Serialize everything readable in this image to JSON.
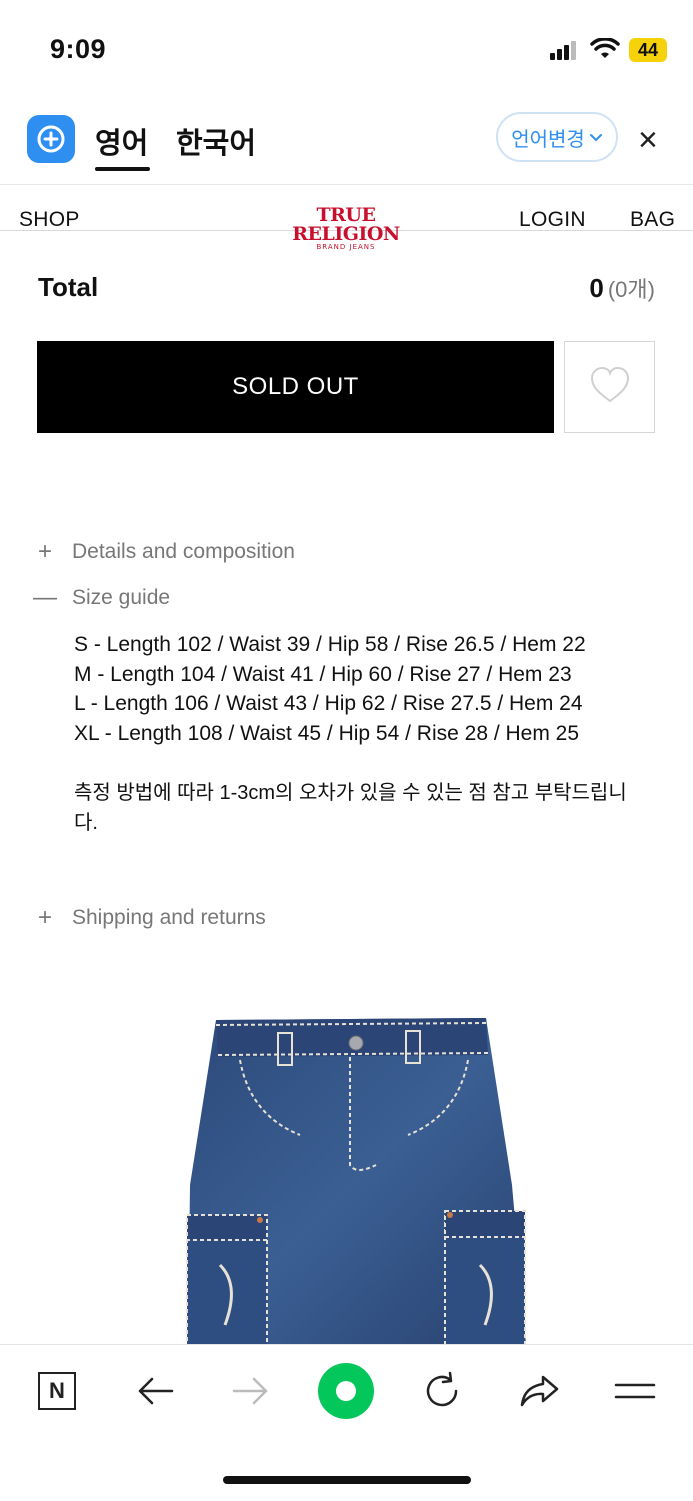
{
  "status_bar": {
    "time": "9:09",
    "battery": "44"
  },
  "translate_bar": {
    "tabs": [
      "영어",
      "한국어"
    ],
    "active_tab": "영어",
    "change_language": "언어변경",
    "close_symbol": "×"
  },
  "site_header": {
    "shop": "SHOP",
    "logo_main": "TRUE RELIGION",
    "logo_sub": "BRAND JEANS",
    "login": "LOGIN",
    "bag": "BAG"
  },
  "total": {
    "label": "Total",
    "value": "0",
    "count": "(0개)"
  },
  "buttons": {
    "sold_out": "SOLD OUT"
  },
  "accordions": {
    "details": {
      "sign": "+",
      "label": "Details and composition"
    },
    "size_guide": {
      "sign": "—",
      "label": "Size guide"
    },
    "shipping": {
      "sign": "+",
      "label": "Shipping and returns"
    }
  },
  "size_guide": {
    "lines": [
      "S - Length 102 / Waist 39 / Hip 58 / Rise 26.5 / Hem 22",
      "M - Length 104 / Waist 41 / Hip 60 / Rise 27 / Hem 23",
      "L - Length 106 / Waist 43 / Hip 62 / Rise 27.5 / Hem 24",
      "XL - Length 108 / Waist 45 / Hip 54 / Rise 28 / Hem 25"
    ],
    "note": "측정 방법에 따라 1-3cm의 오차가 있을 수 있는 점 참고 부탁드립니다."
  },
  "toolbar": {
    "icons": [
      "naver-n-icon",
      "back-arrow-icon",
      "forward-arrow-icon",
      "green-circle-icon",
      "refresh-icon",
      "share-icon",
      "menu-icon"
    ],
    "n_label": "N"
  },
  "colors": {
    "accent": "#2f8ff0",
    "brand_red": "#c8102e",
    "green": "#03c75a",
    "battery": "#f5d20a"
  }
}
